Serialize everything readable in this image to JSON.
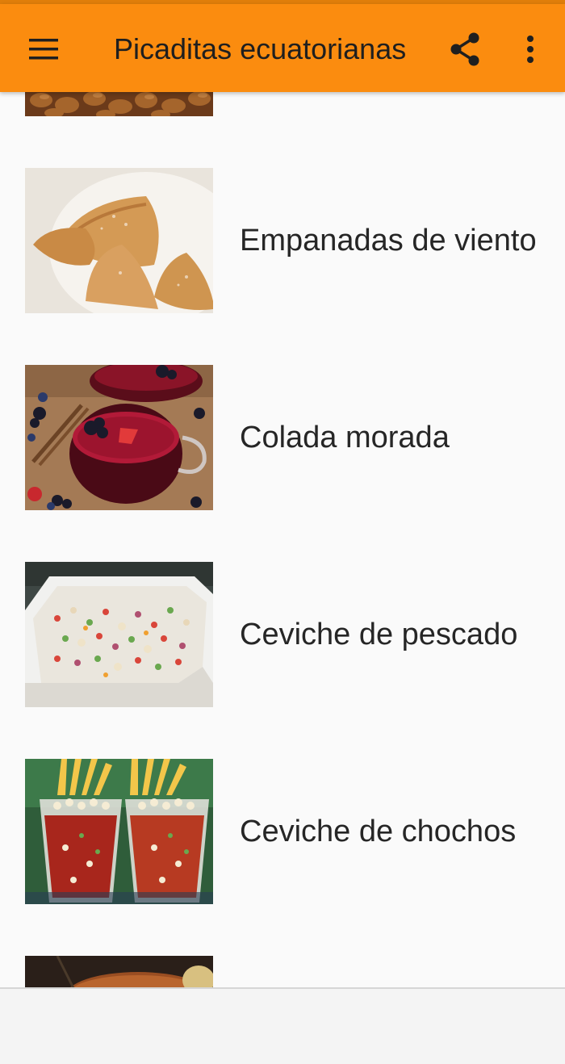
{
  "app_bar": {
    "title": "Picaditas ecuatorianas",
    "background": "#fb8c0f",
    "menu_icon": "hamburger-menu-icon",
    "share_icon": "share-icon",
    "more_icon": "more-vertical-icon"
  },
  "recipes": [
    {
      "label": "",
      "image": "fried-nuts-photo"
    },
    {
      "label": "Empanadas de viento",
      "image": "empanadas-photo"
    },
    {
      "label": "Colada morada",
      "image": "colada-morada-photo"
    },
    {
      "label": "Ceviche de pescado",
      "image": "ceviche-pescado-photo"
    },
    {
      "label": "Ceviche de chochos",
      "image": "ceviche-chochos-photo"
    },
    {
      "label": "",
      "image": "bread-photo"
    }
  ]
}
